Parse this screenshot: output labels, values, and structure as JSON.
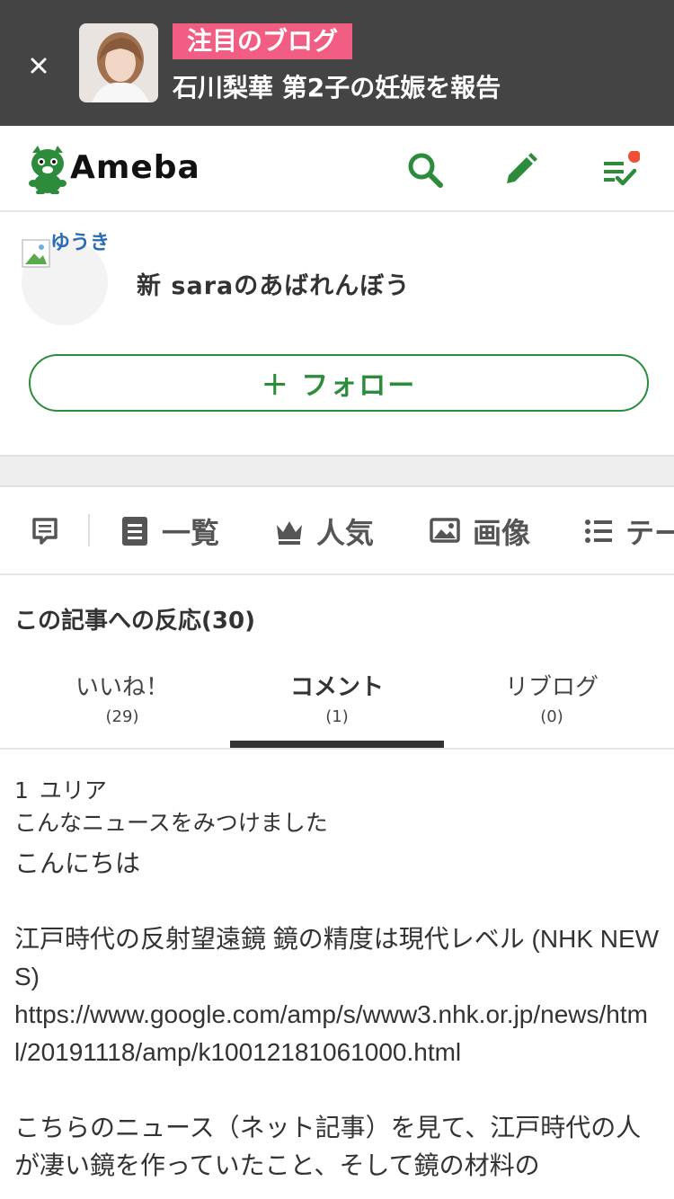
{
  "banner": {
    "tag": "注目のブログ",
    "headline": "石川梨華 第2子の妊娠を報告",
    "icons": [
      "close-icon",
      "featured-thumbnail"
    ]
  },
  "header": {
    "logo_text": "Ameba",
    "icons": [
      "search-icon",
      "pencil-icon",
      "reading-list-icon"
    ],
    "accent_color": "#2d8c3c",
    "notification_color": "#f04e37"
  },
  "profile": {
    "avatar_alt": "ゆうき",
    "blog_title": "新 saraのあばれんぼう",
    "follow_label": "＋ フォロー"
  },
  "nav": {
    "items": [
      {
        "icon": "comment-icon",
        "label": ""
      },
      {
        "icon": "list-icon",
        "label": "一覧"
      },
      {
        "icon": "crown-icon",
        "label": "人気"
      },
      {
        "icon": "image-icon",
        "label": "画像"
      },
      {
        "icon": "theme-list-icon",
        "label": "テー"
      }
    ]
  },
  "reactions": {
    "title": "この記事への反応(30)",
    "tabs": [
      {
        "label": "いいね！",
        "count": "(29)"
      },
      {
        "label": "コメント",
        "count": "(1)"
      },
      {
        "label": "リブログ",
        "count": "(0)"
      }
    ],
    "active_tab": "コメント"
  },
  "comment": {
    "number": "1",
    "author": "ユリア",
    "subtitle": "こんなニュースをみつけました",
    "body": "こんにちは\n\n江戸時代の反射望遠鏡 鏡の精度は現代レベル (NHK NEWS)\nhttps://www.google.com/amp/s/www3.nhk.or.jp/news/html/20191118/amp/k10012181061000.html\n\nこちらのニュース（ネット記事）を見て、江戸時代の人が凄い鏡を作っていたこと、そして鏡の材料の"
  }
}
